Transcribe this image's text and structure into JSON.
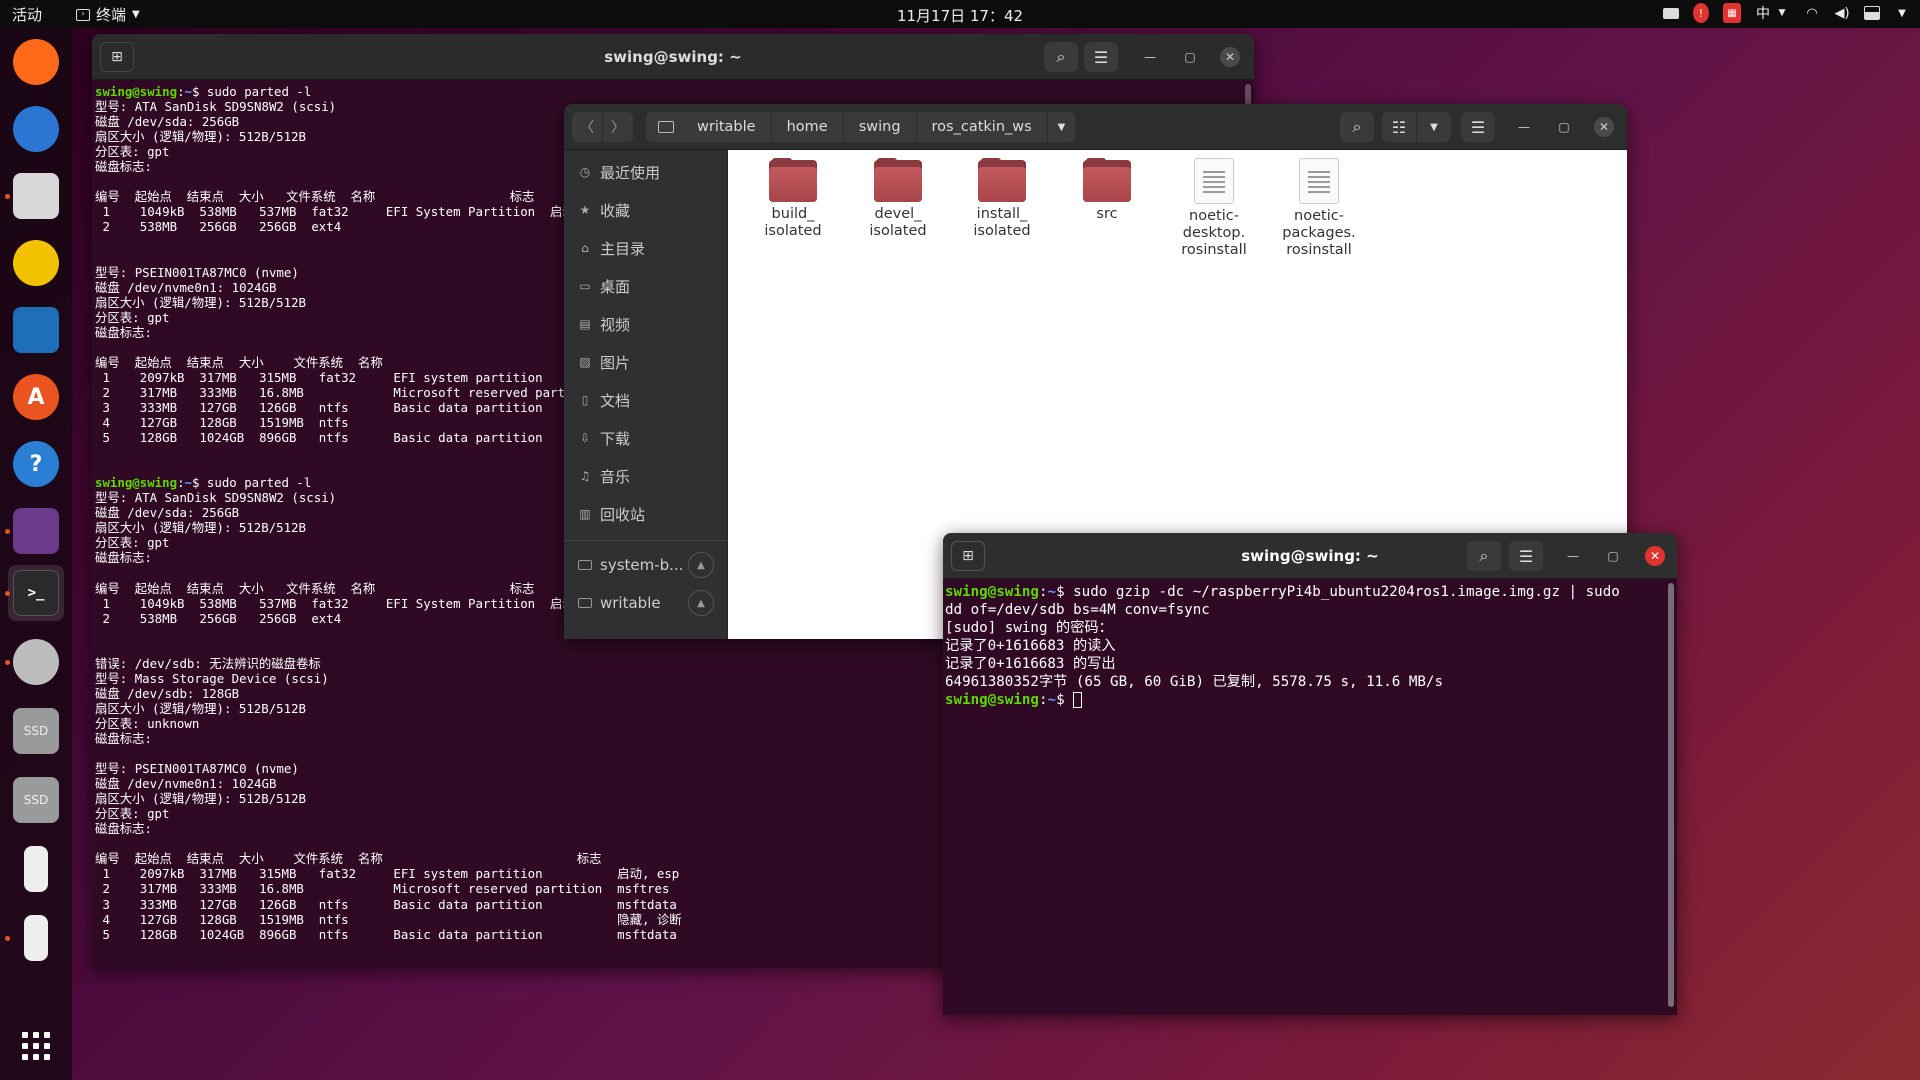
{
  "topbar": {
    "activities": "活动",
    "app_menu": "终端",
    "clock": "11月17日  17：42",
    "input_method": "中"
  },
  "dock": {
    "items": [
      {
        "name": "firefox-icon",
        "color": "#ff6a1a",
        "glyph": "",
        "running": false
      },
      {
        "name": "thunderbird-icon",
        "color": "#2a76d2",
        "glyph": "",
        "running": false
      },
      {
        "name": "files-icon",
        "color": "#d8d8d8",
        "glyph": "",
        "running": true
      },
      {
        "name": "rhythmbox-icon",
        "color": "#f2c200",
        "glyph": "",
        "running": false
      },
      {
        "name": "libreoffice-writer-icon",
        "color": "#1f6fb8",
        "glyph": "",
        "running": false
      },
      {
        "name": "ubuntu-software-icon",
        "color": "#e95420",
        "glyph": "A",
        "running": false
      },
      {
        "name": "help-icon",
        "color": "#2a7fd4",
        "glyph": "?",
        "running": false
      },
      {
        "name": "video-player-icon",
        "color": "#6b3a8a",
        "glyph": "",
        "running": true
      },
      {
        "name": "terminal-icon",
        "color": "#2b2b2b",
        "glyph": ">_",
        "running": true
      },
      {
        "name": "disk-utility-icon",
        "color": "#bdbdbd",
        "glyph": "",
        "running": true
      },
      {
        "name": "ssd-drive-icon",
        "color": "#9a9a9a",
        "glyph": "SSD",
        "running": false
      },
      {
        "name": "ssd-drive-icon-2",
        "color": "#9a9a9a",
        "glyph": "SSD",
        "running": false
      },
      {
        "name": "usb-drive-icon",
        "color": "#e8e8e8",
        "glyph": "",
        "running": false
      },
      {
        "name": "usb-drive-icon-2",
        "color": "#e8e8e8",
        "glyph": "",
        "running": true
      }
    ]
  },
  "terminal1": {
    "title": "swing@swing: ~",
    "lines": [
      {
        "p": "swing@swing",
        "path": "~",
        "cmd": "$ sudo parted -l"
      },
      {
        "t": "型号: ATA SanDisk SD9SN8W2 (scsi)"
      },
      {
        "t": "磁盘 /dev/sda: 256GB"
      },
      {
        "t": "扇区大小 (逻辑/物理): 512B/512B"
      },
      {
        "t": "分区表: gpt"
      },
      {
        "t": "磁盘标志: "
      },
      {
        "t": ""
      },
      {
        "t": "编号  起始点  结束点  大小   文件系统  名称                  标志"
      },
      {
        "t": " 1    1049kB  538MB   537MB  fat32     EFI System Partition  启动, esp"
      },
      {
        "t": " 2    538MB   256GB   256GB  ext4"
      },
      {
        "t": ""
      },
      {
        "t": ""
      },
      {
        "t": "型号: PSEIN001TA87MC0 (nvme)"
      },
      {
        "t": "磁盘 /dev/nvme0n1: 1024GB"
      },
      {
        "t": "扇区大小 (逻辑/物理): 512B/512B"
      },
      {
        "t": "分区表: gpt"
      },
      {
        "t": "磁盘标志: "
      },
      {
        "t": ""
      },
      {
        "t": "编号  起始点  结束点  大小    文件系统  名称                          标志"
      },
      {
        "t": " 1    2097kB  317MB   315MB   fat32     EFI system partition          启动, esp"
      },
      {
        "t": " 2    317MB   333MB   16.8MB            Microsoft reserved partition  msftres"
      },
      {
        "t": " 3    333MB   127GB   126GB   ntfs      Basic data partition          msftdata"
      },
      {
        "t": " 4    127GB   128GB   1519MB  ntfs                                    隐藏, 诊断"
      },
      {
        "t": " 5    128GB   1024GB  896GB   ntfs      Basic data partition          msftdata"
      },
      {
        "t": ""
      },
      {
        "t": ""
      },
      {
        "p": "swing@swing",
        "path": "~",
        "cmd": "$ sudo parted -l"
      },
      {
        "t": "型号: ATA SanDisk SD9SN8W2 (scsi)"
      },
      {
        "t": "磁盘 /dev/sda: 256GB"
      },
      {
        "t": "扇区大小 (逻辑/物理): 512B/512B"
      },
      {
        "t": "分区表: gpt"
      },
      {
        "t": "磁盘标志: "
      },
      {
        "t": ""
      },
      {
        "t": "编号  起始点  结束点  大小   文件系统  名称                  标志"
      },
      {
        "t": " 1    1049kB  538MB   537MB  fat32     EFI System Partition  启动, esp"
      },
      {
        "t": " 2    538MB   256GB   256GB  ext4"
      },
      {
        "t": ""
      },
      {
        "t": ""
      },
      {
        "t": "错误: /dev/sdb: 无法辨识的磁盘卷标"
      },
      {
        "t": "型号: Mass Storage Device (scsi)"
      },
      {
        "t": "磁盘 /dev/sdb: 128GB"
      },
      {
        "t": "扇区大小 (逻辑/物理): 512B/512B"
      },
      {
        "t": "分区表: unknown"
      },
      {
        "t": "磁盘标志: "
      },
      {
        "t": ""
      },
      {
        "t": "型号: PSEIN001TA87MC0 (nvme)"
      },
      {
        "t": "磁盘 /dev/nvme0n1: 1024GB"
      },
      {
        "t": "扇区大小 (逻辑/物理): 512B/512B"
      },
      {
        "t": "分区表: gpt"
      },
      {
        "t": "磁盘标志: "
      },
      {
        "t": ""
      },
      {
        "t": "编号  起始点  结束点  大小    文件系统  名称                          标志"
      },
      {
        "t": " 1    2097kB  317MB   315MB   fat32     EFI system partition          启动, esp"
      },
      {
        "t": " 2    317MB   333MB   16.8MB            Microsoft reserved partition  msftres"
      },
      {
        "t": " 3    333MB   127GB   126GB   ntfs      Basic data partition          msftdata"
      },
      {
        "t": " 4    127GB   128GB   1519MB  ntfs                                    隐藏, 诊断"
      },
      {
        "t": " 5    128GB   1024GB  896GB   ntfs      Basic data partition          msftdata"
      }
    ]
  },
  "files": {
    "breadcrumbs": [
      "writable",
      "home",
      "swing",
      "ros_catkin_ws"
    ],
    "sidebar": [
      {
        "label": "最近使用",
        "icon": "recent-icon",
        "glyph": "◷"
      },
      {
        "label": "收藏",
        "icon": "star-icon",
        "glyph": "★"
      },
      {
        "label": "主目录",
        "icon": "home-icon",
        "glyph": "⌂"
      },
      {
        "label": "桌面",
        "icon": "desktop-icon",
        "glyph": "▭"
      },
      {
        "label": "视频",
        "icon": "video-icon",
        "glyph": "▤"
      },
      {
        "label": "图片",
        "icon": "picture-icon",
        "glyph": "▨"
      },
      {
        "label": "文档",
        "icon": "document-icon",
        "glyph": "▯"
      },
      {
        "label": "下载",
        "icon": "download-icon",
        "glyph": "⇩"
      },
      {
        "label": "音乐",
        "icon": "music-icon",
        "glyph": "♫"
      },
      {
        "label": "回收站",
        "icon": "trash-icon",
        "glyph": "▥"
      }
    ],
    "devices": [
      {
        "label": "system-b..."
      },
      {
        "label": "writable"
      }
    ],
    "items": [
      {
        "name": "build_\nisolated",
        "type": "folder"
      },
      {
        "name": "devel_\nisolated",
        "type": "folder"
      },
      {
        "name": "install_\nisolated",
        "type": "folder"
      },
      {
        "name": "src",
        "type": "folder"
      },
      {
        "name": "noetic-\ndesktop.\nrosinstall",
        "type": "file"
      },
      {
        "name": "noetic-\npackages.\nrosinstall",
        "type": "file"
      }
    ]
  },
  "terminal2": {
    "title": "swing@swing: ~",
    "lines": [
      {
        "p": "swing@swing",
        "path": "~",
        "cmd": "$ sudo gzip -dc ~/raspberryPi4b_ubuntu2204ros1.image.img.gz | sudo"
      },
      {
        "t": "dd of=/dev/sdb bs=4M conv=fsync"
      },
      {
        "t": "[sudo] swing 的密码："
      },
      {
        "t": "记录了0+1616683 的读入"
      },
      {
        "t": "记录了0+1616683 的写出"
      },
      {
        "t": "64961380352字节 (65 GB, 60 GiB) 已复制, 5578.75 s, 11.6 MB/s"
      },
      {
        "p": "swing@swing",
        "path": "~",
        "cmd": "$ ",
        "cursor": true
      }
    ]
  }
}
